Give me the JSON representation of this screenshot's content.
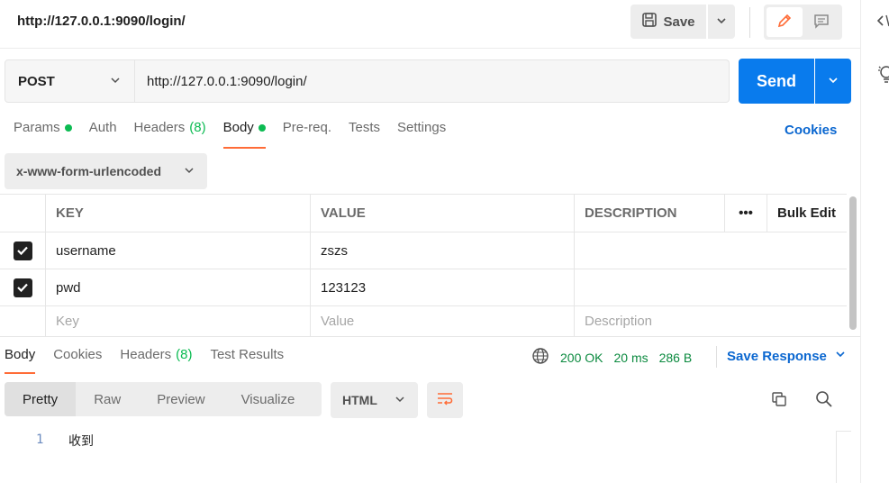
{
  "header": {
    "tab_url": "http://127.0.0.1:9090/login/",
    "save_label": "Save"
  },
  "request": {
    "method": "POST",
    "url": "http://127.0.0.1:9090/login/",
    "send_label": "Send"
  },
  "request_tabs": [
    {
      "label": "Params",
      "dot": true
    },
    {
      "label": "Auth"
    },
    {
      "label": "Headers",
      "count": "(8)"
    },
    {
      "label": "Body",
      "dot": true,
      "active": true
    },
    {
      "label": "Pre-req."
    },
    {
      "label": "Tests"
    },
    {
      "label": "Settings"
    }
  ],
  "cookies_label": "Cookies",
  "body_type": "x-www-form-urlencoded",
  "params_table": {
    "headers": {
      "key": "KEY",
      "value": "VALUE",
      "description": "DESCRIPTION",
      "more": "•••",
      "bulk_edit": "Bulk Edit"
    },
    "rows": [
      {
        "key": "username",
        "value": "zszs",
        "description": "",
        "checked": true
      },
      {
        "key": "pwd",
        "value": "123123",
        "description": "",
        "checked": true
      }
    ],
    "placeholders": {
      "key": "Key",
      "value": "Value",
      "description": "Description"
    }
  },
  "response_tabs": [
    {
      "label": "Body",
      "active": true
    },
    {
      "label": "Cookies"
    },
    {
      "label": "Headers",
      "count": "(8)"
    },
    {
      "label": "Test Results"
    }
  ],
  "response_meta": {
    "status": "200 OK",
    "time": "20 ms",
    "size": "286 B",
    "save_response": "Save Response"
  },
  "view_tabs": [
    "Pretty",
    "Raw",
    "Preview",
    "Visualize"
  ],
  "format": "HTML",
  "code": {
    "line_number": "1",
    "line_content": "收到"
  },
  "colors": {
    "accent": "#097bed",
    "tab_underline": "#ff6c37",
    "status_green": "#0cbb52",
    "link": "#0b67d0"
  },
  "icons": [
    "save-icon",
    "chevron-down-icon",
    "pencil-icon",
    "comment-icon",
    "code-icon",
    "lightbulb-icon",
    "globe-icon",
    "wrap-lines-icon",
    "copy-icon",
    "search-icon",
    "checkmark-icon"
  ]
}
